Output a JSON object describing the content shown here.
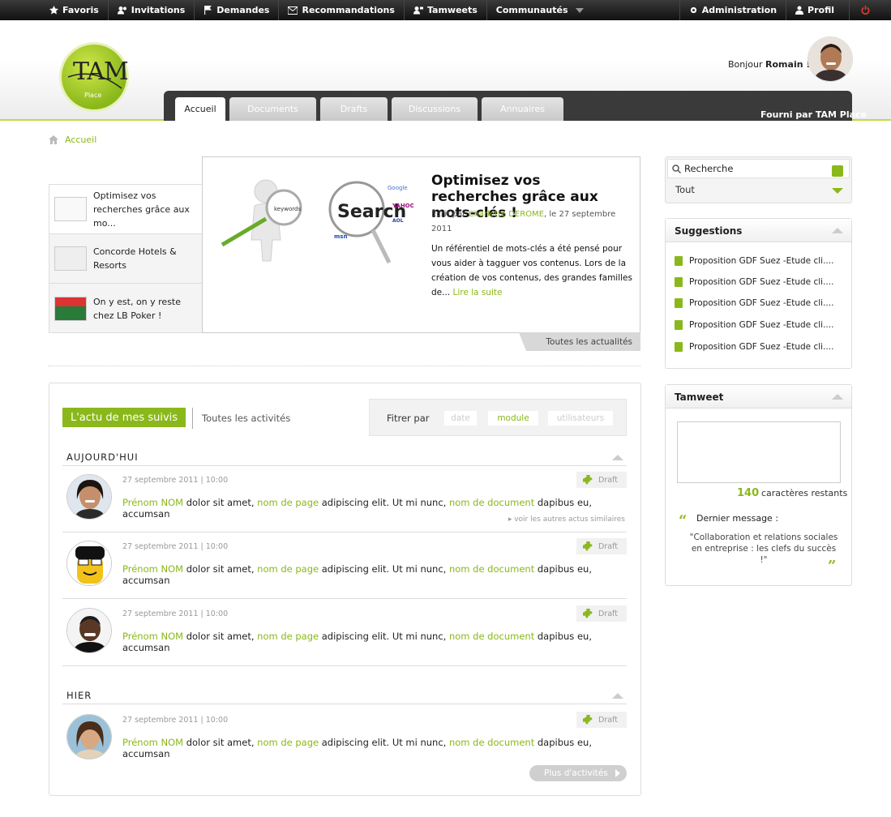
{
  "topnav": {
    "left": [
      {
        "label": "Favoris",
        "icon": "star-icon"
      },
      {
        "label": "Invitations",
        "icon": "users-icon"
      },
      {
        "label": "Demandes",
        "icon": "flag-icon"
      },
      {
        "label": "Recommandations",
        "icon": "envelope-icon"
      },
      {
        "label": "Tamweets",
        "icon": "chat-icon"
      },
      {
        "label": "Communautés",
        "icon": "chevron-down-icon"
      }
    ],
    "right": [
      {
        "label": "Administration",
        "icon": "gear-icon"
      },
      {
        "label": "Profil",
        "icon": "user-icon"
      }
    ]
  },
  "header": {
    "logo_text": "TAM",
    "logo_sub": "Place",
    "greeting": "Bonjour",
    "user_name": "Romain !",
    "powered": "Fourni par TAM Place",
    "tabs": [
      "Accueil",
      "Documents",
      "Drafts",
      "Discussions",
      "Annuaires"
    ]
  },
  "breadcrumb": "Accueil",
  "carousel": {
    "items": [
      "Optimisez vos recherches grâce aux mo...",
      "Concorde Hotels & Resorts",
      "On y est, on y reste chez LB Poker !"
    ],
    "feature": {
      "title": "Optimisez vos recherches grâce aux mots-clés !",
      "by": "Ecrit par",
      "author": "Charlotte DEROME",
      "date": ", le 27 septembre 2011",
      "body": "Un référentiel de mots-clés a été pensé pour vous aider à tagguer vos contenus. Lors de la création de vos contenus, des grandes familles de...",
      "more": "Lire la suite",
      "image_label_1": "keywords",
      "image_label_2": "Search"
    },
    "all_news": "Toutes les actualités"
  },
  "activity": {
    "active_tab": "L'actu de mes suivis",
    "other_tab": "Toutes les activités",
    "filter_label": "Fitrer par",
    "filters": [
      "date",
      "module",
      "utilisateurs"
    ],
    "today_label": "AUJOURD'HUI",
    "yesterday_label": "HIER",
    "posts": [
      {
        "date": "27 septembre 2011   |   10:00",
        "name": "Prénom NOM",
        "t1": " dolor sit amet, ",
        "page": "nom de page",
        "t2": " adipiscing elit. Ut mi nunc, ",
        "doc": "nom de document",
        "t3": " dapibus eu, accumsan",
        "badge": "Draft"
      },
      {
        "date": "27 septembre 2011   |   10:00",
        "name": "Prénom NOM",
        "t1": " dolor sit amet, ",
        "page": "nom de page",
        "t2": " adipiscing elit. Ut mi nunc, ",
        "doc": "nom de document",
        "t3": " dapibus eu, accumsan",
        "badge": "Draft"
      },
      {
        "date": "27 septembre 2011   |   10:00",
        "name": "Prénom NOM",
        "t1": " dolor sit amet, ",
        "page": "nom de page",
        "t2": " adipiscing elit. Ut mi nunc, ",
        "doc": "nom de document",
        "t3": " dapibus eu, accumsan",
        "badge": "Draft"
      },
      {
        "date": "27 septembre 2011   |   10:00",
        "name": "Prénom NOM",
        "t1": " dolor sit amet, ",
        "page": "nom de page",
        "t2": " adipiscing elit. Ut mi nunc, ",
        "doc": "nom de document",
        "t3": " dapibus eu, accumsan",
        "badge": "Draft"
      }
    ],
    "similar": "▸  voir les autres actus similaires",
    "more": "Plus d'activités"
  },
  "search": {
    "placeholder": "Recherche",
    "scope": "Tout"
  },
  "suggestions": {
    "title": "Suggestions",
    "items": [
      "Proposition GDF Suez -Etude cli....",
      "Proposition GDF Suez -Etude cli....",
      "Proposition GDF Suez -Etude cli....",
      "Proposition GDF Suez -Etude cli....",
      "Proposition GDF Suez -Etude cli...."
    ]
  },
  "tamweet": {
    "title": "Tamweet",
    "count": "140",
    "count_label": "caractères restants",
    "last_label": "Dernier message :",
    "last_message": "\"Collaboration et relations sociales en entreprise : les clefs du succès !\""
  },
  "colors": {
    "accent": "#8ab81a",
    "dark": "#3a3a3a"
  }
}
